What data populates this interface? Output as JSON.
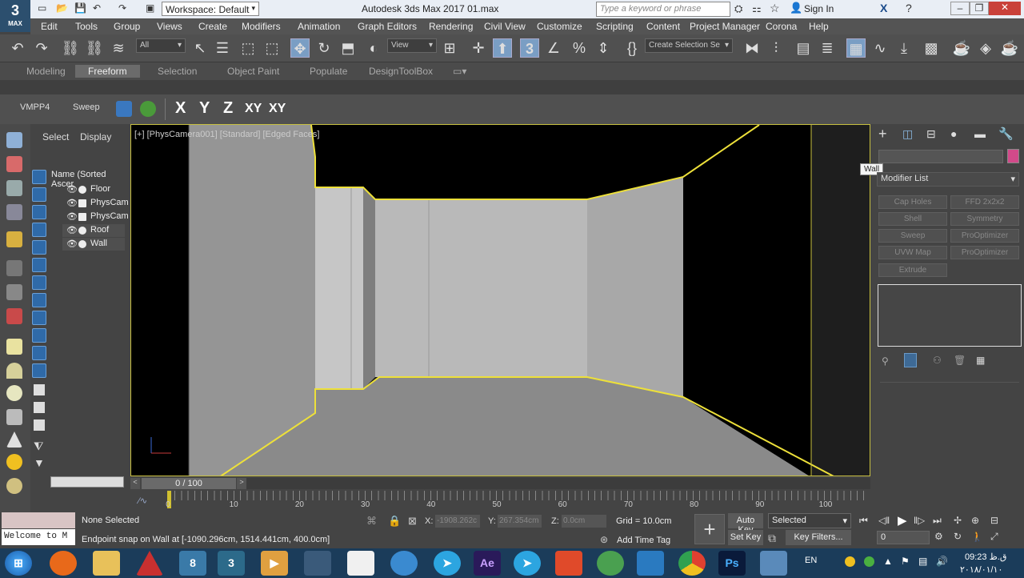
{
  "app": {
    "logo_main": "3",
    "logo_sub": "MAX",
    "window_title": "Autodesk 3ds Max 2017     01.max",
    "workspace_label": "Workspace: Default",
    "search_placeholder": "Type a keyword or phrase",
    "signin_label": "Sign In"
  },
  "menu": {
    "items": [
      "Edit",
      "Tools",
      "Group",
      "Views",
      "Create",
      "Modifiers",
      "Animation",
      "Graph Editors",
      "Rendering",
      "Civil View",
      "Customize",
      "Scripting",
      "Content",
      "Project Manager",
      "Corona",
      "Help"
    ]
  },
  "toolbar": {
    "filter_all": "All",
    "view_combo": "View",
    "selection_set": "Create Selection Se",
    "snap_label": "3"
  },
  "ribbon": {
    "tabs": [
      "Modeling",
      "Freeform",
      "Selection",
      "Object Paint",
      "Populate",
      "DesignToolBox"
    ],
    "active_tab": "Freeform"
  },
  "freeform_toolbar": {
    "vmpp": "VMPP4",
    "sweep": "Sweep",
    "axes": [
      "X",
      "Y",
      "Z",
      "XY",
      "XY"
    ]
  },
  "scene_explorer": {
    "tab_select": "Select",
    "tab_display": "Display",
    "column_header": "Name (Sorted Ascer",
    "items": [
      {
        "name": "Floor",
        "type": "object"
      },
      {
        "name": "PhysCam",
        "type": "camera"
      },
      {
        "name": "PhysCam",
        "type": "camera"
      },
      {
        "name": "Roof",
        "type": "object",
        "selected": true
      },
      {
        "name": "Wall",
        "type": "object",
        "selected": true
      }
    ]
  },
  "viewport": {
    "label": "[+] [PhysCamera001] [Standard] [Edged Faces]"
  },
  "command_panel": {
    "object_name": "",
    "tooltip": "Wall",
    "color_swatch": "#d24a8a",
    "modifier_list_label": "Modifier List",
    "modifier_buttons": [
      "Cap Holes",
      "FFD 2x2x2",
      "Shell",
      "Symmetry",
      "Sweep",
      "ProOptimizer",
      "UVW Map",
      "ProOptimizer",
      "Extrude"
    ]
  },
  "timeline": {
    "frame_display": "0 / 100",
    "ticks": [
      "0",
      "10",
      "20",
      "30",
      "40",
      "50",
      "60",
      "70",
      "80",
      "90",
      "100"
    ]
  },
  "status": {
    "maxscript_listener": "Welcome to M",
    "selection_status": "None Selected",
    "prompt": "Endpoint snap on Wall at [-1090.296cm, 1514.441cm, 400.0cm]",
    "x_label": "X:",
    "x_value": "-1908.262c",
    "y_label": "Y:",
    "y_value": "267.354cm",
    "z_label": "Z:",
    "z_value": "0.0cm",
    "grid": "Grid = 10.0cm",
    "add_time_tag": "Add Time Tag",
    "auto_key": "Auto Key",
    "set_key": "Set Key",
    "selected_combo": "Selected",
    "key_filters": "Key Filters...",
    "frame_value": "0"
  },
  "taskbar": {
    "lang": "EN",
    "time": "09:23 ق.ظ",
    "date": "۲۰۱۸/۰۱/۱۰",
    "apps": [
      "windows-start",
      "firefox",
      "file-explorer",
      "autocad",
      "windows8-app",
      "3dsmax",
      "media-player",
      "network",
      "blank-doc",
      "chat",
      "telegram",
      "after-effects",
      "telegram",
      "office",
      "globe",
      "cube",
      "chrome",
      "photoshop",
      "remote-desktop"
    ]
  }
}
